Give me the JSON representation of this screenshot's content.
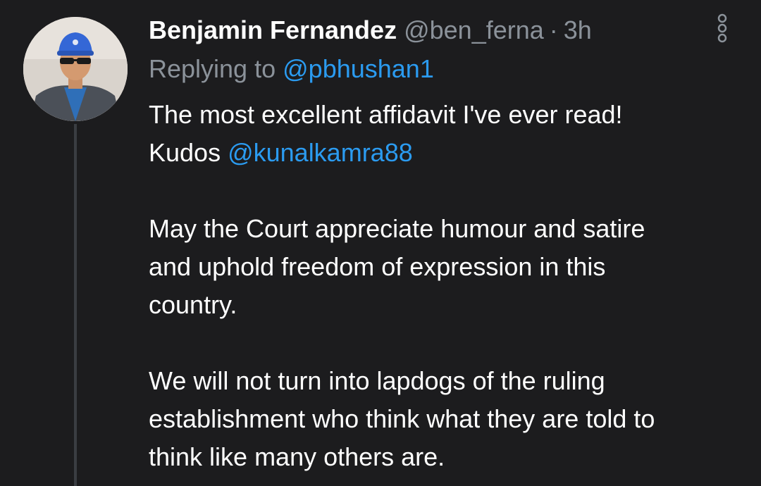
{
  "tweet": {
    "author": {
      "display_name": "Benjamin Fernandez",
      "handle": "@ben_ferna",
      "avatar_icon": "profile-photo"
    },
    "separator": "·",
    "time": "3h",
    "more_icon": "vertical-ellipsis-icon",
    "reply": {
      "prefix": "Replying to",
      "mention": "@pbhushan1"
    },
    "body": {
      "line1": "The most excellent affidavit I've ever read!",
      "line2_text": "Kudos ",
      "line2_mention": "@kunalkamra88",
      "para2_line1": "May the Court appreciate humour and satire",
      "para2_line2": "and uphold freedom of expression in this",
      "para2_line3": "country.",
      "para3_line1": "We will not turn into lapdogs of the ruling",
      "para3_line2": "establishment who think what they are told to",
      "para3_line3": "think like many others are."
    }
  },
  "colors": {
    "background": "#1c1c1e",
    "text_primary": "#ffffff",
    "text_secondary": "#8b929a",
    "link": "#2b9bf0",
    "thread_line": "#3a3d42"
  }
}
